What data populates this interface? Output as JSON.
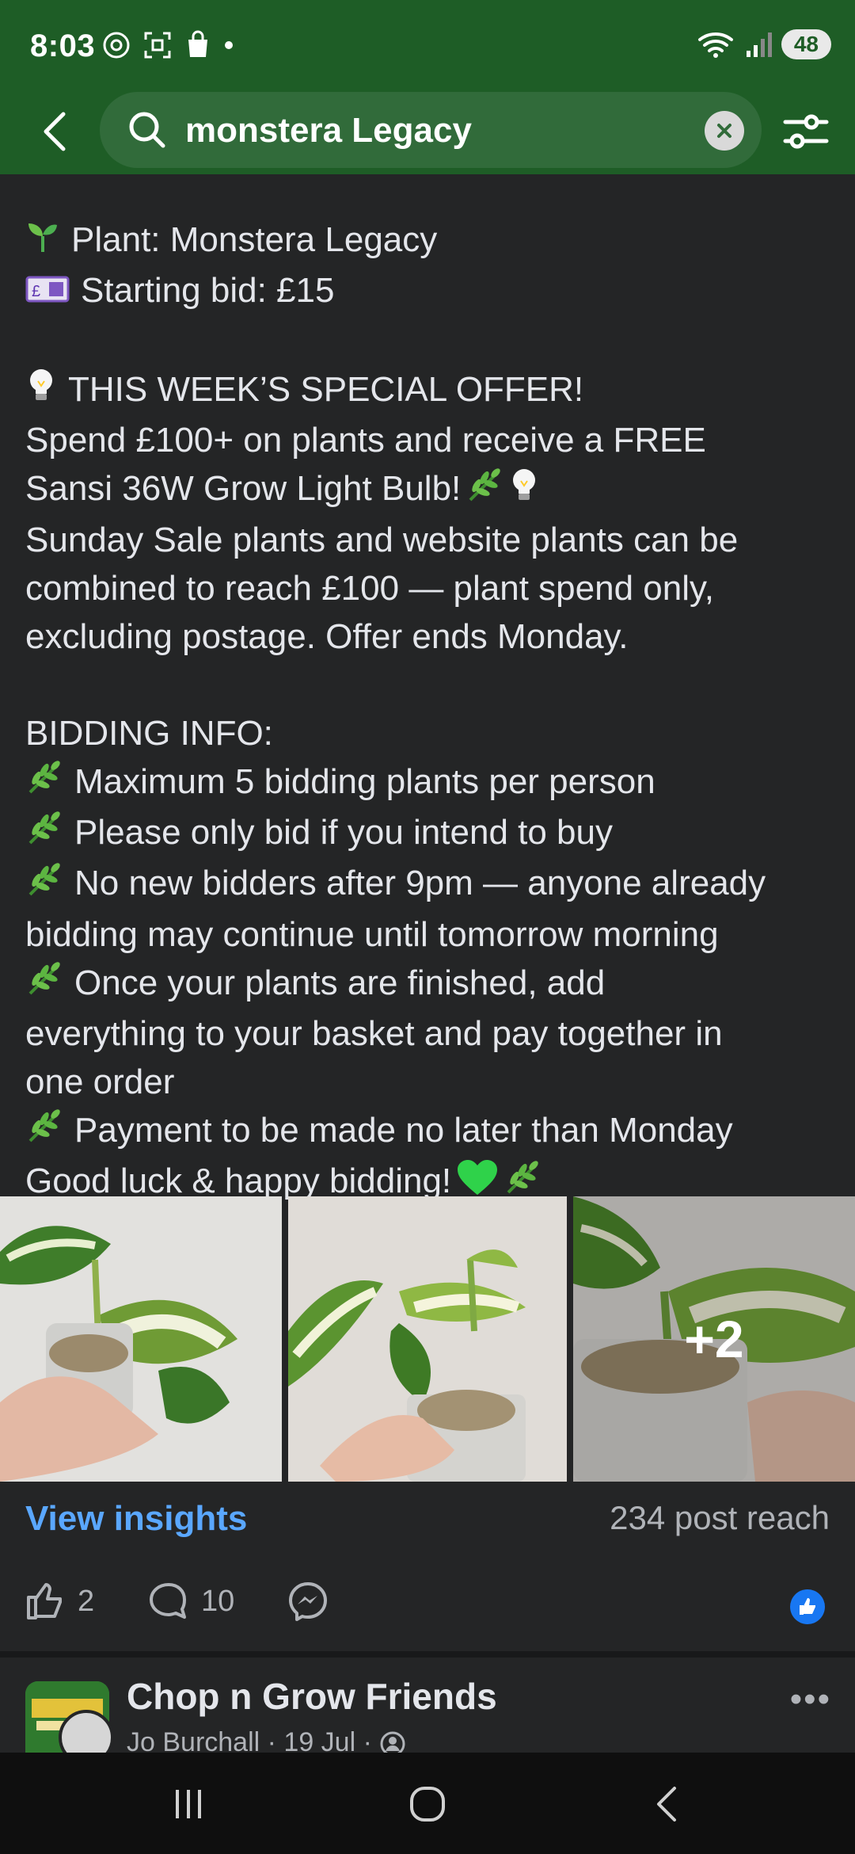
{
  "status_bar": {
    "time": "8:03",
    "battery": "48"
  },
  "search": {
    "query": "monstera Legacy"
  },
  "post": {
    "lines": [
      {
        "emoji": "seedling",
        "text": "Plant: Monstera Legacy"
      },
      {
        "emoji": "money",
        "text": "Starting bid: £15"
      },
      {
        "gap": true
      },
      {
        "emoji": "bulb",
        "text": "THIS WEEK’S SPECIAL OFFER!"
      },
      {
        "text": "Spend £100+ on plants and receive a FREE"
      },
      {
        "text": "Sansi 36W Grow Light Bulb!",
        "trail": [
          "herb",
          "bulb"
        ]
      },
      {
        "text": "Sunday Sale plants and website plants can be"
      },
      {
        "text": "combined to reach £100 — plant spend only,"
      },
      {
        "text": "excluding postage. Offer ends Monday."
      },
      {
        "gap": true
      },
      {
        "text": "BIDDING INFO:"
      },
      {
        "emoji": "herb",
        "text": "Maximum 5 bidding plants per person"
      },
      {
        "emoji": "herb",
        "text": "Please only bid if you intend to buy"
      },
      {
        "emoji": "herb",
        "text": "No new bidders after 9pm — anyone already"
      },
      {
        "text": "bidding may continue until tomorrow morning"
      },
      {
        "emoji": "herb",
        "text": "Once your plants are finished, add"
      },
      {
        "text": "everything to your basket and pay together in"
      },
      {
        "text": "one order"
      },
      {
        "emoji": "herb",
        "text": "Payment to be made no later than Monday"
      },
      {
        "text": "Good luck & happy bidding!",
        "trail": [
          "heart",
          "herb"
        ]
      }
    ],
    "more_photos": "+2",
    "view_insights": "View insights",
    "post_reach": "234 post reach",
    "like_count": "2",
    "comment_count": "10"
  },
  "next_post": {
    "group_name": "Chop n Grow Friends",
    "meta": "Jo Burchall · 19 Jul ·"
  },
  "colors": {
    "header": "#1e5d26",
    "background": "#242526",
    "link": "#5aa7ff",
    "reaction": "#1877f2"
  }
}
